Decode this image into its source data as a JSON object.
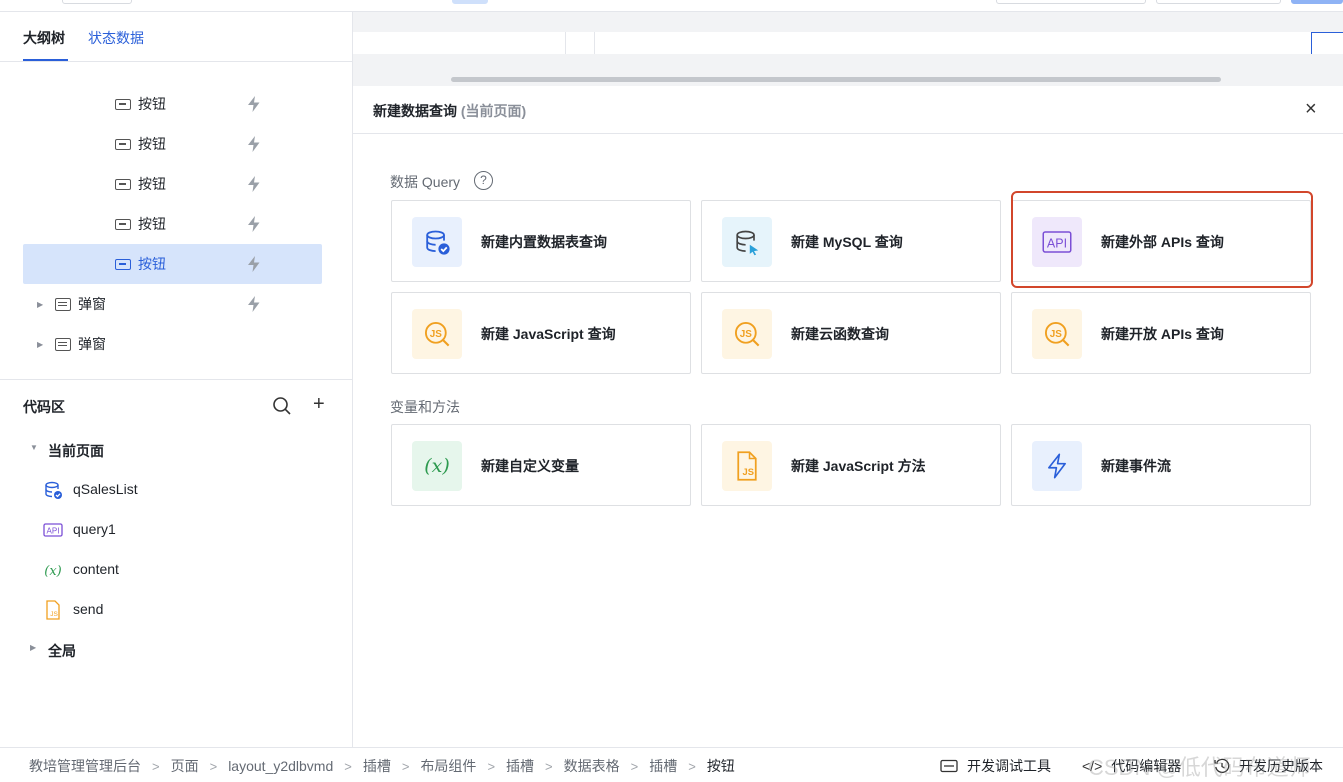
{
  "outline": {
    "tabs": [
      "大纲树",
      "状态数据"
    ],
    "items": [
      {
        "label": "按钮"
      },
      {
        "label": "按钮"
      },
      {
        "label": "按钮"
      },
      {
        "label": "按钮"
      },
      {
        "label": "按钮",
        "selected": true
      },
      {
        "label": "弹窗"
      },
      {
        "label": "弹窗"
      }
    ]
  },
  "code_area": {
    "title": "代码区",
    "current_page": "当前页面",
    "items": [
      {
        "label": "qSalesList",
        "icon": "database-icon"
      },
      {
        "label": "query1",
        "icon": "api-icon"
      },
      {
        "label": "content",
        "icon": "variable-icon"
      },
      {
        "label": "send",
        "icon": "js-file-icon"
      }
    ],
    "global": "全局"
  },
  "dialog": {
    "title": "新建数据查询",
    "subtitle": "(当前页面)",
    "close": "×",
    "query_section": "数据 Query",
    "help": "?",
    "query_cards": [
      "新建内置数据表查询",
      "新建 MySQL 查询",
      "新建外部 APIs 查询",
      "新建 JavaScript 查询",
      "新建云函数查询",
      "新建开放 APIs 查询"
    ],
    "var_section": "变量和方法",
    "var_cards": [
      "新建自定义变量",
      "新建 JavaScript 方法",
      "新建事件流"
    ]
  },
  "footer": {
    "crumbs": [
      "教培管理管理后台",
      "页面",
      "layout_y2dlbvmd",
      "插槽",
      "布局组件",
      "插槽",
      "数据表格",
      "插槽",
      "按钮"
    ],
    "separator": ">",
    "tools": [
      "开发调试工具",
      "代码编辑器",
      "开发历史版本"
    ],
    "watermark": "CSDN @低代码布道师"
  },
  "colors": {
    "accent": "#2a5fd9",
    "highlight": "#d2462b"
  }
}
